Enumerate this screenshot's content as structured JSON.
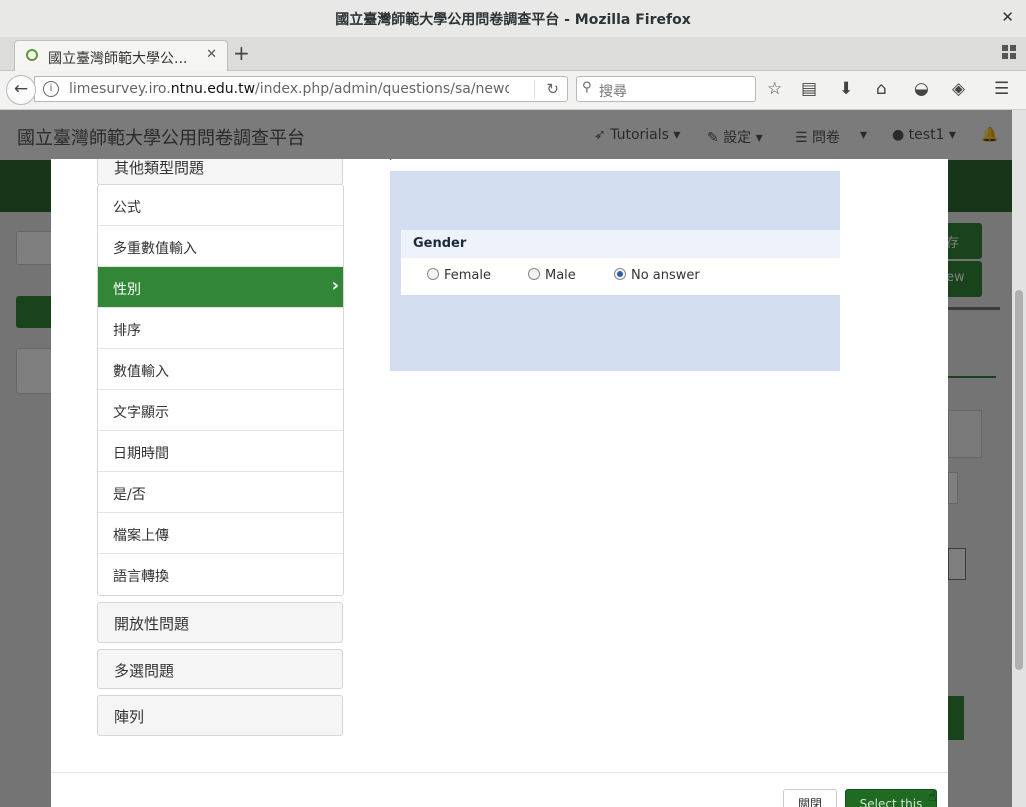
{
  "window": {
    "title": "國立臺灣師範大學公用問卷調查平台 - Mozilla Firefox",
    "close_glyph": "✕"
  },
  "tabs": [
    {
      "label": "國立臺灣師範大學公...",
      "close_glyph": "✕"
    }
  ],
  "toolbar": {
    "newtab_glyph": "+",
    "url_prefix": "limesurvey.iro.",
    "url_domain": "ntnu.edu.tw",
    "url_suffix": "/index.php/admin/questions/sa/newquestic",
    "search_placeholder": "搜尋"
  },
  "app": {
    "title": "國立臺灣師範大學公用問卷調查平台",
    "nav": {
      "tutorials": "Tutorials ▾",
      "settings": "設定 ▾",
      "surveys": "問卷",
      "surveys_caret": "▾",
      "user": "test1 ▾"
    },
    "bg_save": "存",
    "bg_new": "ew"
  },
  "modal": {
    "cut_group": "其他類型問題",
    "items": [
      "公式",
      "多重數值輸入",
      "性別",
      "排序",
      "數值輸入",
      "文字顯示",
      "日期時間",
      "是/否",
      "檔案上傳",
      "語言轉換"
    ],
    "active_index": 2,
    "groups": [
      "開放性問題",
      "多選問題",
      "陣列"
    ],
    "preview": {
      "question": "Gender",
      "options": [
        "Female",
        "Male",
        "No answer"
      ],
      "selected": "No answer"
    },
    "close_button": "關閉",
    "select_button": "Select this"
  },
  "colors": {
    "active_item": "#328637",
    "select_button": "#1e6b21",
    "preview_bg": "#d2deef",
    "app_green": "#2f6b31"
  }
}
